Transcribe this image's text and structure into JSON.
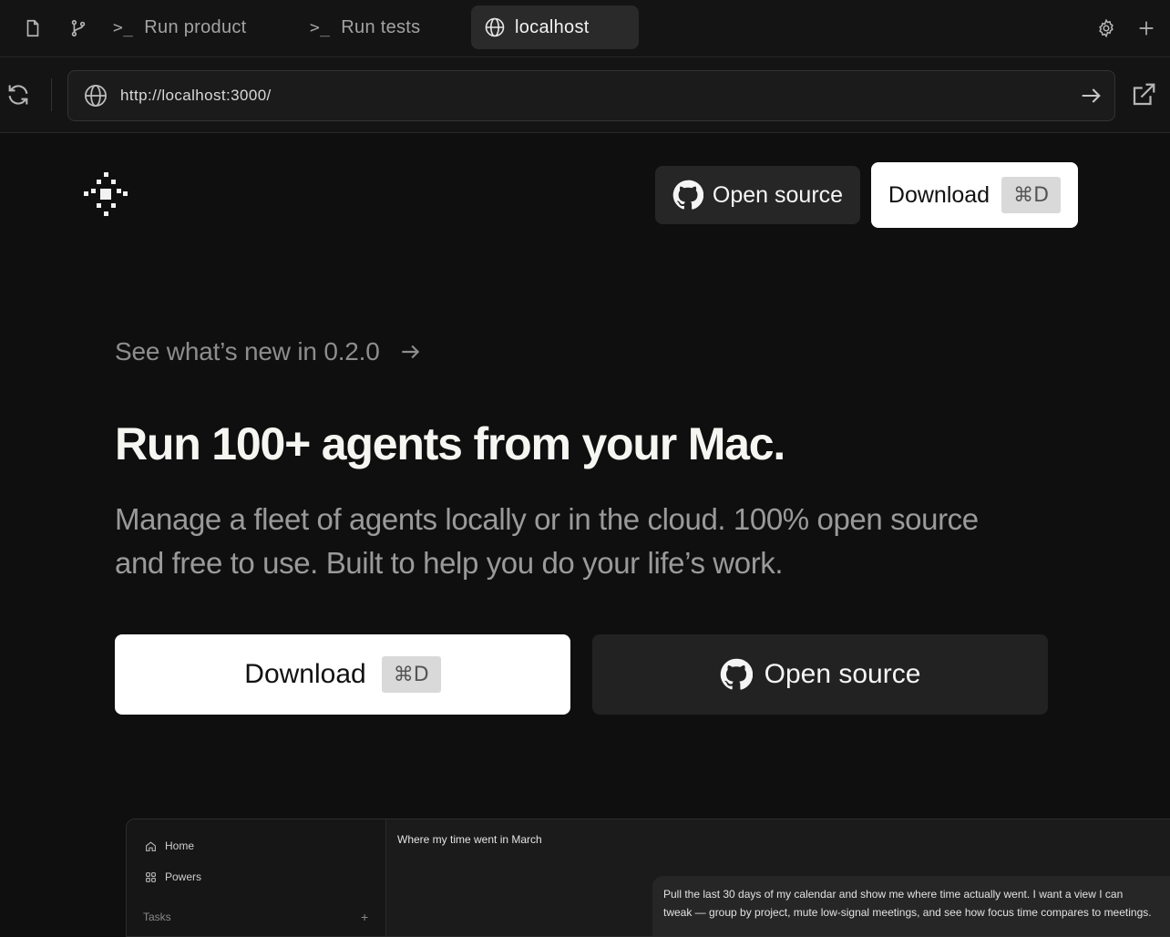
{
  "tabbar": {
    "tabs": [
      {
        "label": "Run product",
        "glyph": ">_"
      },
      {
        "label": "Run tests",
        "glyph": ">_"
      },
      {
        "label": "localhost",
        "icon": "globe-icon",
        "active": true
      }
    ],
    "left_icons": [
      "file-icon",
      "git-branch-icon"
    ],
    "right_icons": [
      "gear-icon",
      "plus-icon"
    ]
  },
  "address": {
    "url": "http://localhost:3000/"
  },
  "nav": {
    "open_source_label": "Open source",
    "download_label": "Download",
    "shortcut": "⌘D"
  },
  "hero": {
    "whats_new": "See what’s new in 0.2.0",
    "headline": "Run 100+ agents from your Mac.",
    "subhead_line1": "Manage a fleet of agents locally or in the cloud. 100% open source",
    "subhead_line2": "and free to use. Built to help you do your life’s work.",
    "download_label": "Download",
    "shortcut": "⌘D",
    "open_source_label": "Open source"
  },
  "preview": {
    "sidebar": {
      "home_label": "Home",
      "powers_label": "Powers",
      "tasks_label": "Tasks",
      "tasks_add": "+"
    },
    "conversation_title": "Where my time went in March",
    "message_line1": "Pull the last 30 days of my calendar and show me where time actually went. I want a view I can",
    "message_line2": "tweak — group by project, mute low-signal meetings, and see how focus time compares to meetings."
  },
  "colors": {
    "page_bg": "#0f0f0f",
    "chrome_bg": "#141414",
    "button_dark": "#262626",
    "button_light": "#ffffff",
    "muted_text": "#9a9a9a"
  }
}
